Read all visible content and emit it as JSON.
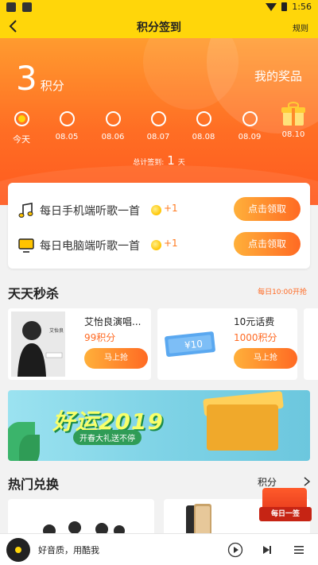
{
  "status": {
    "time": "1:56"
  },
  "nav": {
    "title": "积分签到",
    "rules": "规则"
  },
  "hero": {
    "points_value": "3",
    "points_unit": "积分",
    "my_prizes": "我的奖品",
    "days": [
      {
        "label": "今天",
        "checked": true
      },
      {
        "label": "08.05",
        "checked": false
      },
      {
        "label": "08.06",
        "checked": false
      },
      {
        "label": "08.07",
        "checked": false
      },
      {
        "label": "08.08",
        "checked": false
      },
      {
        "label": "08.09",
        "checked": false
      },
      {
        "label": "08.10",
        "checked": false,
        "gift": true
      }
    ],
    "total_label": "总计签到:",
    "total_count": "1",
    "total_unit": "天"
  },
  "tasks": [
    {
      "label": "每日手机端听歌一首",
      "reward": "+1",
      "button": "点击领取",
      "icon": "music-note-icon"
    },
    {
      "label": "每日电脑端听歌一首",
      "reward": "+1",
      "button": "点击领取",
      "icon": "monitor-icon"
    }
  ],
  "flash_sale": {
    "title": "天天秒杀",
    "subtitle": "每日10:00开抢",
    "items": [
      {
        "name": "艾怡良演唱...",
        "points": "99积分",
        "button": "马上抢",
        "poster_name": "艾怡良"
      },
      {
        "name": "10元话费",
        "points": "1000积分",
        "button": "马上抢",
        "voucher": "¥10"
      }
    ]
  },
  "banner": {
    "slogan": "好运2019",
    "sub": "开春大礼送不停"
  },
  "hot_exchange": {
    "title": "热门兑换",
    "more": "积分"
  },
  "daily_sign_badge": "每日一签",
  "player": {
    "text": "好音质，用酷我"
  },
  "colors": {
    "brand_yellow": "#ffd60a",
    "accent_orange": "#ff6a23"
  }
}
